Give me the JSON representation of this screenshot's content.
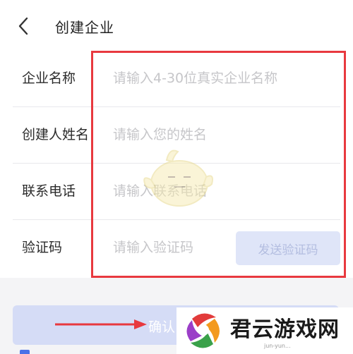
{
  "header": {
    "back_icon": "chevron-left-icon",
    "title": "创建企业"
  },
  "form": {
    "rows": [
      {
        "label": "企业名称",
        "placeholder": "请输入4-30位真实企业名称"
      },
      {
        "label": "创建人姓名",
        "placeholder": "请输入您的姓名"
      },
      {
        "label": "联系电话",
        "placeholder": "请输入联系电话"
      },
      {
        "label": "验证码",
        "placeholder": "请输入验证码"
      }
    ],
    "send_code_label": "发送验证码"
  },
  "confirm_label": "确认",
  "watermark": {
    "text": "君云游戏网",
    "sub": "jun-yun..."
  },
  "colors": {
    "accent": "#4a72e8",
    "highlight": "#e8393f",
    "button_disabled": "#d5dcf6"
  }
}
